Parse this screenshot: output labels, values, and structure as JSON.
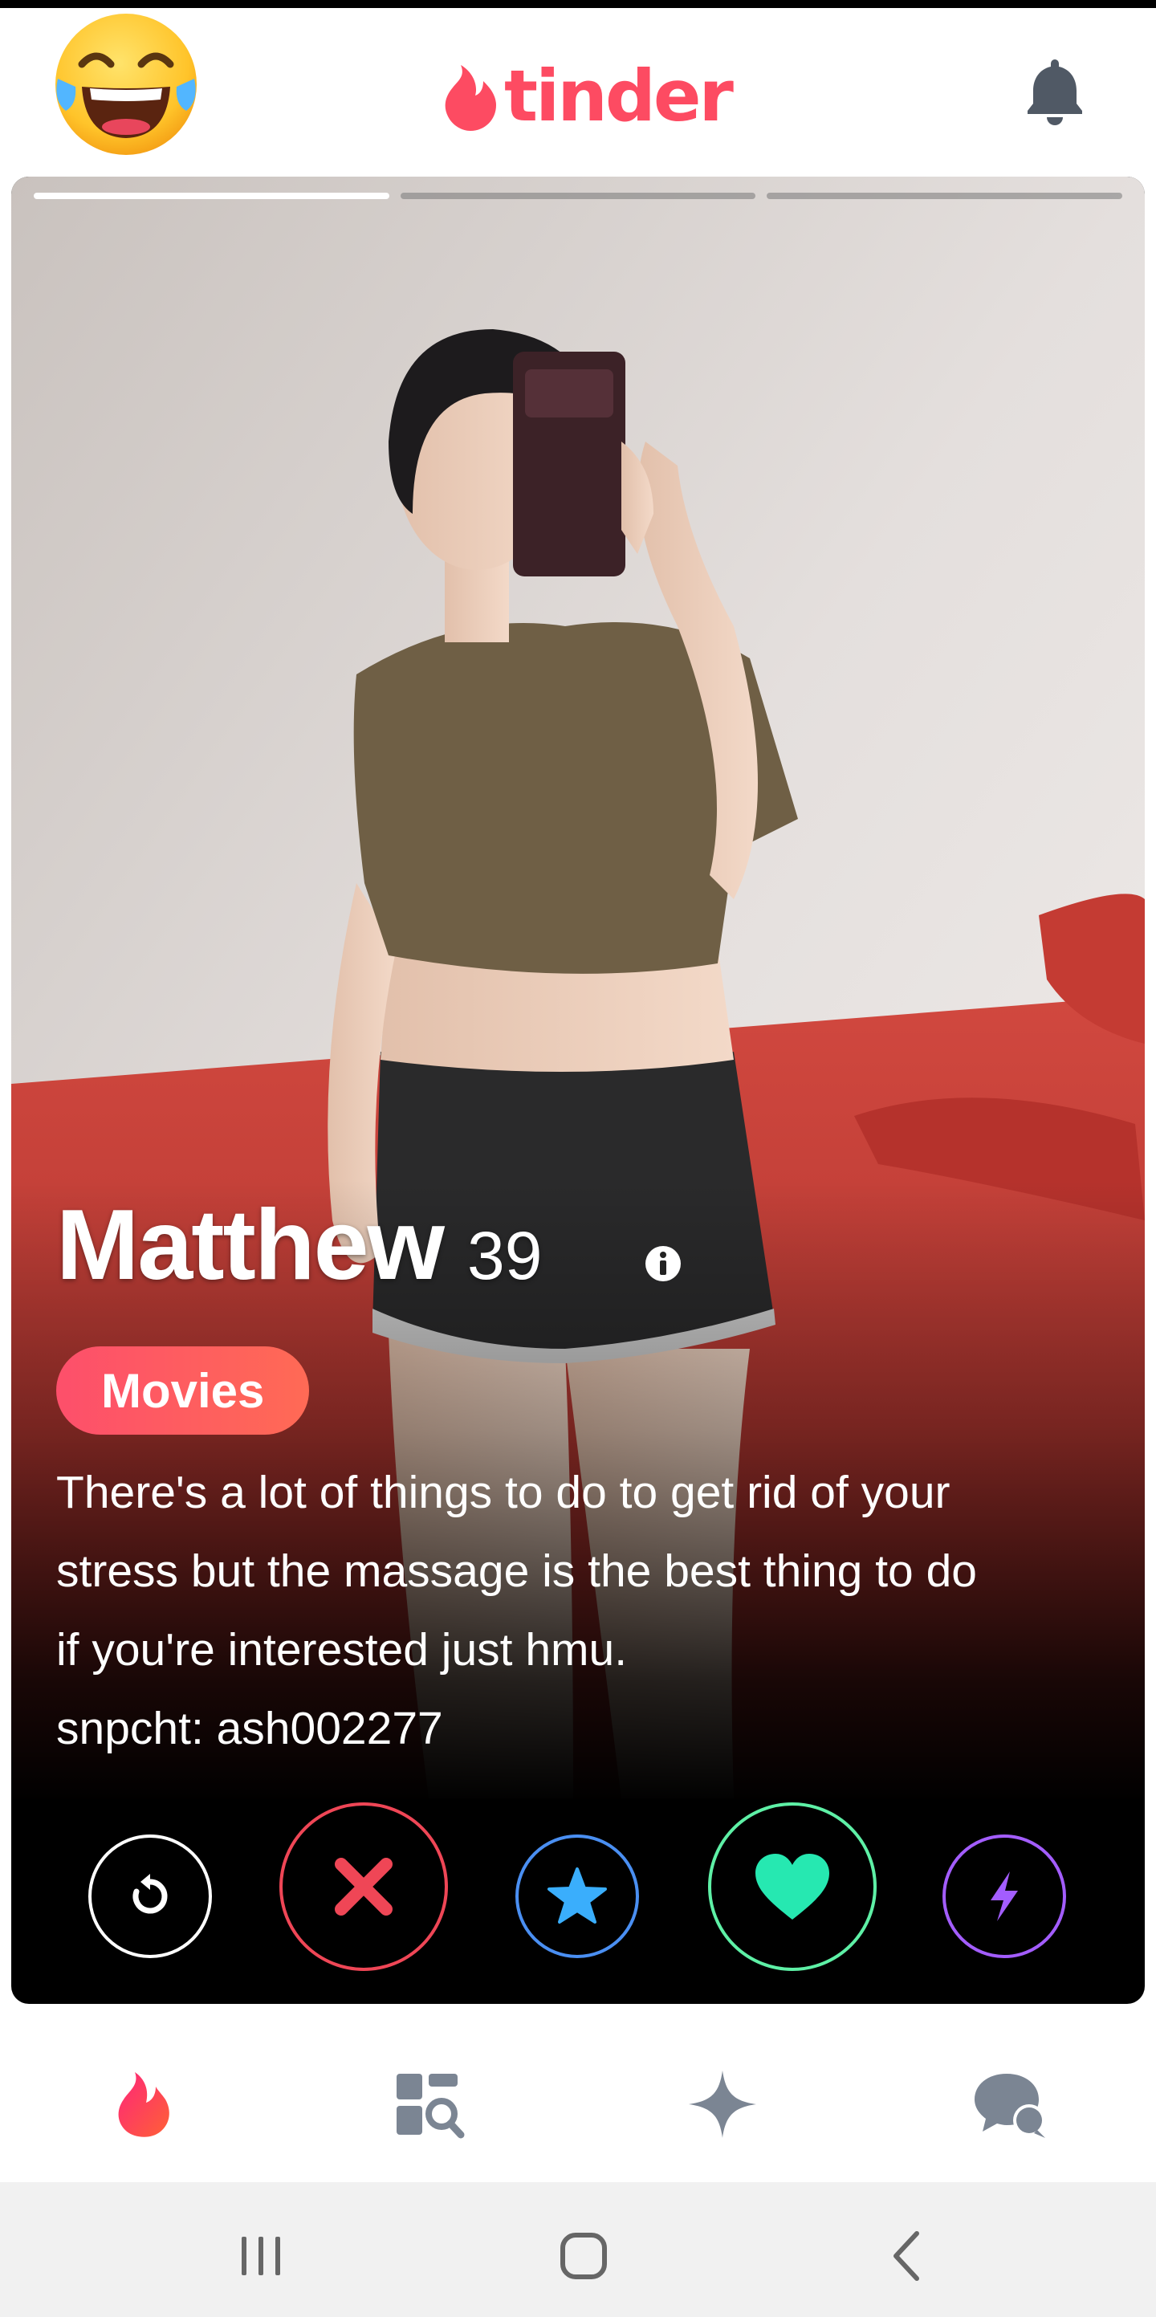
{
  "header": {
    "emoji": "laughing-crying-emoji",
    "logo_text": "tinder",
    "bell_icon": "bell-icon"
  },
  "card": {
    "photos_total": 3,
    "photo_index": 1,
    "name": "Matthew",
    "age": "39",
    "interest_tag": "Movies",
    "bio_lines": [
      "There's a lot of things to do to get rid of your",
      "stress but the massage is the best thing to do",
      "if you're interested just hmu.",
      "snpcht: ash002277"
    ]
  },
  "actions": [
    {
      "name": "rewind",
      "icon": "rewind-icon",
      "color": "#ffffff"
    },
    {
      "name": "nope",
      "icon": "x-icon",
      "color": "#ef4656"
    },
    {
      "name": "super-like",
      "icon": "star-icon",
      "color": "#3aaefc"
    },
    {
      "name": "like",
      "icon": "heart-icon",
      "color": "#26e8b1"
    },
    {
      "name": "boost",
      "icon": "lightning-icon",
      "color": "#a35dff"
    }
  ],
  "bottom_nav": [
    {
      "name": "swipe",
      "icon": "flame-icon",
      "active": true
    },
    {
      "name": "explore",
      "icon": "explore-icon",
      "active": false
    },
    {
      "name": "top-picks",
      "icon": "sparkle-icon",
      "active": false
    },
    {
      "name": "chat",
      "icon": "chat-icon",
      "active": false
    }
  ],
  "colors": {
    "brand": "#fd4b62",
    "nav_inactive": "#7b8593"
  }
}
